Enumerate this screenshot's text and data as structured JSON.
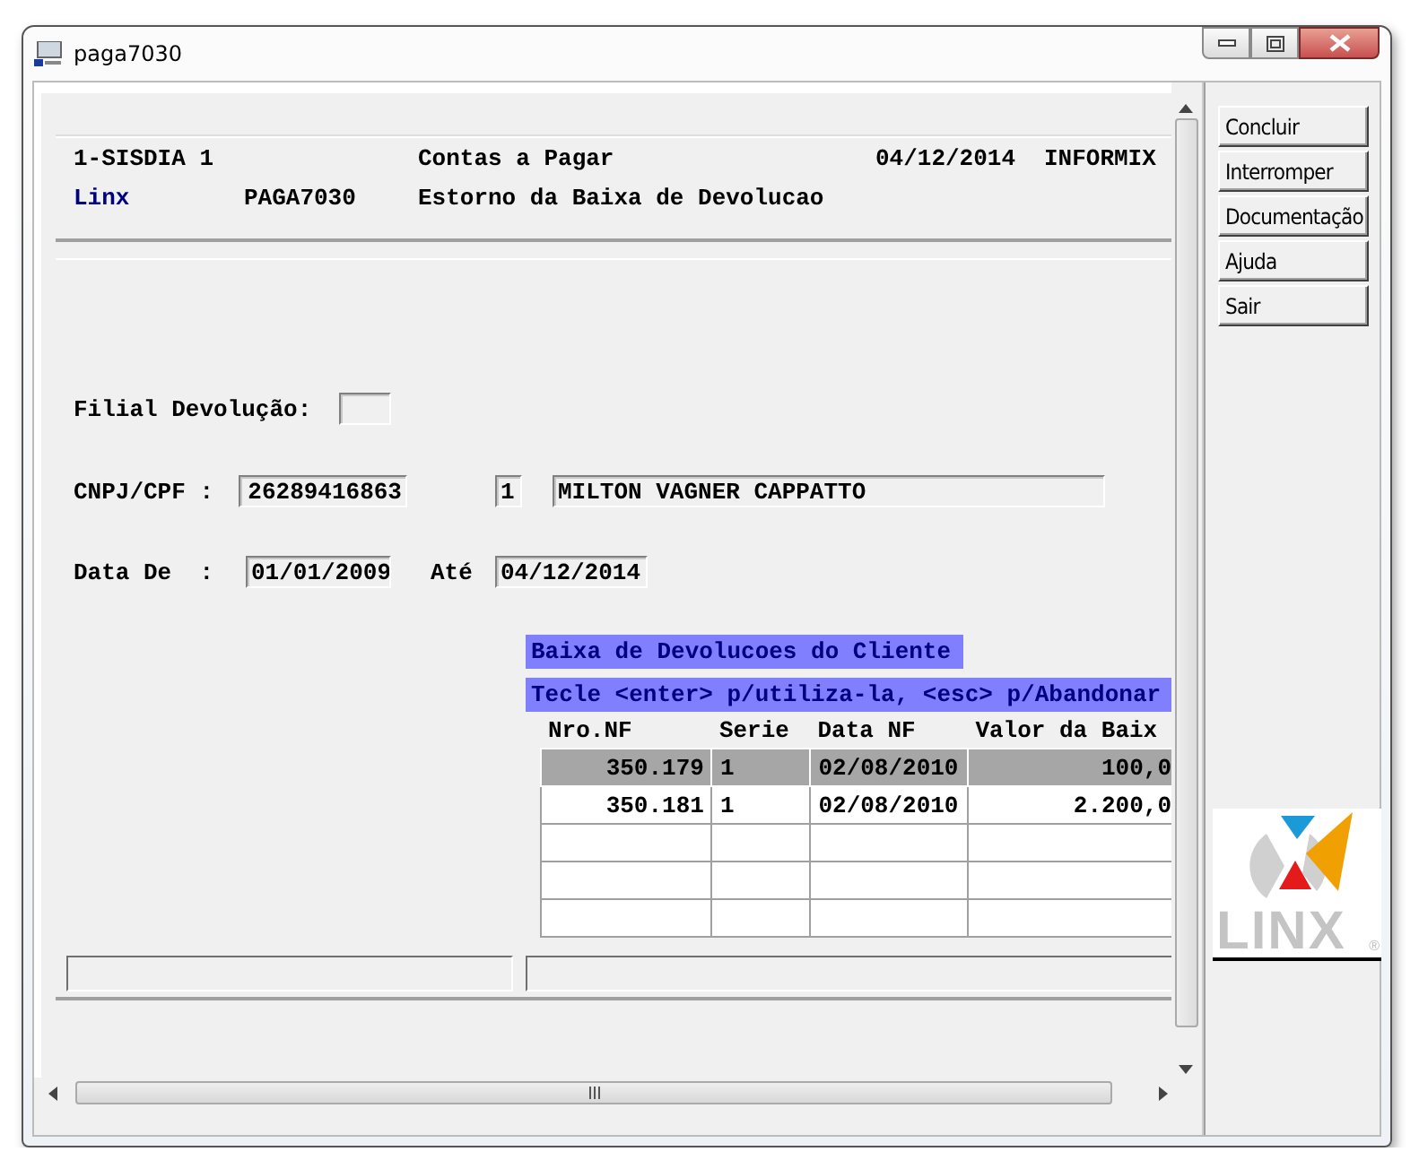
{
  "window": {
    "title": "paga7030"
  },
  "header": {
    "company": "1-SISDIA 1",
    "module": "Contas a Pagar",
    "date": "04/12/2014",
    "database": "INFORMIX",
    "brand": "Linx",
    "program": "PAGA7030",
    "title": "Estorno da Baixa de Devolucao"
  },
  "form": {
    "filial": {
      "label": "Filial Devolução:"
    },
    "client": {
      "label": "CNPJ/CPF :",
      "document": "26289416863",
      "sequence": "1",
      "name": "MILTON VAGNER CAPPATTO"
    },
    "period": {
      "label": "Data De  :",
      "from": "01/01/2009",
      "to_label": "Até",
      "to": "04/12/2014"
    }
  },
  "popup": {
    "title": "Baixa de Devolucoes do Cliente",
    "hint": "Tecle <enter> p/utiliza-la, <esc> p/Abandonar",
    "columns": [
      "Nro.NF",
      "Serie",
      "Data NF",
      "Valor da Baix"
    ],
    "rows": [
      {
        "cells": [
          "350.179",
          "1",
          "02/08/2010",
          "100,0"
        ],
        "selected": true
      },
      {
        "cells": [
          "350.181",
          "1",
          "02/08/2010",
          "2.200,0"
        ],
        "selected": false
      }
    ]
  },
  "buttons": [
    "Concluir",
    "Interromper",
    "Documentação",
    "Ajuda",
    "Sair"
  ],
  "logo": {
    "text": "LINX",
    "mark": "®"
  }
}
